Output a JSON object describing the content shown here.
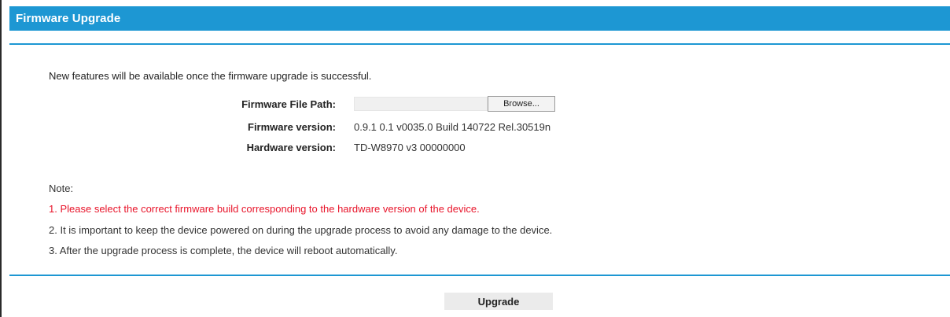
{
  "header": {
    "title": "Firmware Upgrade"
  },
  "intro": "New features will be available once the firmware upgrade is successful.",
  "form": {
    "file_path_label": "Firmware File Path:",
    "file_path_value": "",
    "browse_label": "Browse...",
    "firmware_version_label": "Firmware version:",
    "firmware_version_value": "0.9.1 0.1 v0035.0 Build 140722 Rel.30519n",
    "hardware_version_label": "Hardware version:",
    "hardware_version_value": "TD-W8970 v3 00000000"
  },
  "notes": {
    "title": "Note:",
    "items": [
      "1. Please select the correct firmware build corresponding to the hardware version of the device.",
      "2. It is important to keep the device powered on during the upgrade process to avoid any damage to the device.",
      "3. After the upgrade process is complete, the device will reboot automatically."
    ]
  },
  "actions": {
    "upgrade_label": "Upgrade"
  },
  "colors": {
    "accent": "#1d97d3",
    "warning": "#e8142a"
  }
}
